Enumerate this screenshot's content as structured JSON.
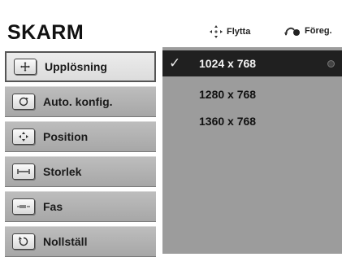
{
  "header": {
    "title": "SKARM",
    "hints": [
      {
        "label": "Flytta",
        "icon": "move-arrows-icon"
      },
      {
        "label": "Föreg.",
        "icon": "back-icon"
      }
    ]
  },
  "menu": {
    "items": [
      {
        "label": "Upplösning",
        "icon": "resolution-icon",
        "active": true
      },
      {
        "label": "Auto. konfig.",
        "icon": "auto-config-icon",
        "active": false
      },
      {
        "label": "Position",
        "icon": "position-icon",
        "active": false
      },
      {
        "label": "Storlek",
        "icon": "size-icon",
        "active": false
      },
      {
        "label": "Fas",
        "icon": "phase-icon",
        "active": false
      },
      {
        "label": "Nollställ",
        "icon": "reset-icon",
        "active": false
      }
    ]
  },
  "panel": {
    "options": [
      {
        "label": "1024 x 768",
        "selected": true
      },
      {
        "label": "1280 x 768",
        "selected": false
      },
      {
        "label": "1360 x 768",
        "selected": false
      }
    ],
    "check_glyph": "✓"
  },
  "colors": {
    "menu_bg": "#b4b4b4",
    "panel_bg": "#9c9c9c",
    "selected_bg": "#202020"
  }
}
